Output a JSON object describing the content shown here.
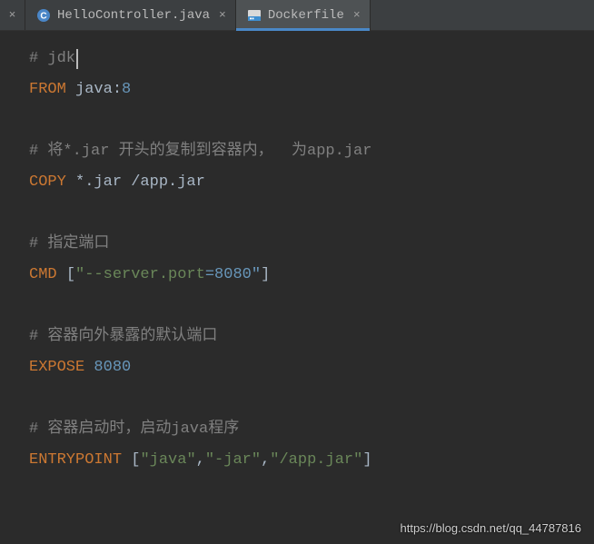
{
  "tabs": {
    "orphan_close": "×",
    "items": [
      {
        "label": "HelloController.java",
        "active": false,
        "icon": "java",
        "close": "×"
      },
      {
        "label": "Dockerfile",
        "active": true,
        "icon": "docker",
        "close": "×"
      }
    ]
  },
  "editor": {
    "lines": [
      {
        "tokens": [
          {
            "t": "# jdk",
            "c": "c-comment"
          }
        ],
        "cursor": true
      },
      {
        "tokens": [
          {
            "t": "FROM",
            "c": "c-keyword"
          },
          {
            "t": " ",
            "c": ""
          },
          {
            "t": "java",
            "c": "c-ident"
          },
          {
            "t": ":",
            "c": "c-colon"
          },
          {
            "t": "8",
            "c": "c-number"
          }
        ]
      },
      {
        "tokens": []
      },
      {
        "tokens": [
          {
            "t": "# 将*.jar 开头的复制到容器内，  为app.jar",
            "c": "c-comment"
          }
        ]
      },
      {
        "tokens": [
          {
            "t": "COPY",
            "c": "c-keyword"
          },
          {
            "t": " ",
            "c": ""
          },
          {
            "t": "*.jar /app.jar",
            "c": "c-ident"
          }
        ]
      },
      {
        "tokens": []
      },
      {
        "tokens": [
          {
            "t": "# 指定端口",
            "c": "c-comment"
          }
        ]
      },
      {
        "tokens": [
          {
            "t": "CMD",
            "c": "c-keyword"
          },
          {
            "t": " ",
            "c": ""
          },
          {
            "t": "[",
            "c": "c-bracket"
          },
          {
            "t": "\"--server.port",
            "c": "c-string"
          },
          {
            "t": "=8080\"",
            "c": "c-eq"
          },
          {
            "t": "]",
            "c": "c-bracket"
          }
        ]
      },
      {
        "tokens": []
      },
      {
        "tokens": [
          {
            "t": "# 容器向外暴露的默认端口",
            "c": "c-comment"
          }
        ]
      },
      {
        "tokens": [
          {
            "t": "EXPOSE",
            "c": "c-keyword"
          },
          {
            "t": " ",
            "c": ""
          },
          {
            "t": "8080",
            "c": "c-number"
          }
        ]
      },
      {
        "tokens": []
      },
      {
        "tokens": [
          {
            "t": "# 容器启动时，启动java程序",
            "c": "c-comment"
          }
        ]
      },
      {
        "tokens": [
          {
            "t": "ENTRYPOINT",
            "c": "c-keyword"
          },
          {
            "t": " ",
            "c": ""
          },
          {
            "t": "[",
            "c": "c-bracket"
          },
          {
            "t": "\"java\"",
            "c": "c-string"
          },
          {
            "t": ",",
            "c": "c-ident"
          },
          {
            "t": "\"-jar\"",
            "c": "c-string"
          },
          {
            "t": ",",
            "c": "c-ident"
          },
          {
            "t": "\"/app.jar\"",
            "c": "c-string"
          },
          {
            "t": "]",
            "c": "c-bracket"
          }
        ]
      }
    ]
  },
  "watermark": "https://blog.csdn.net/qq_44787816"
}
